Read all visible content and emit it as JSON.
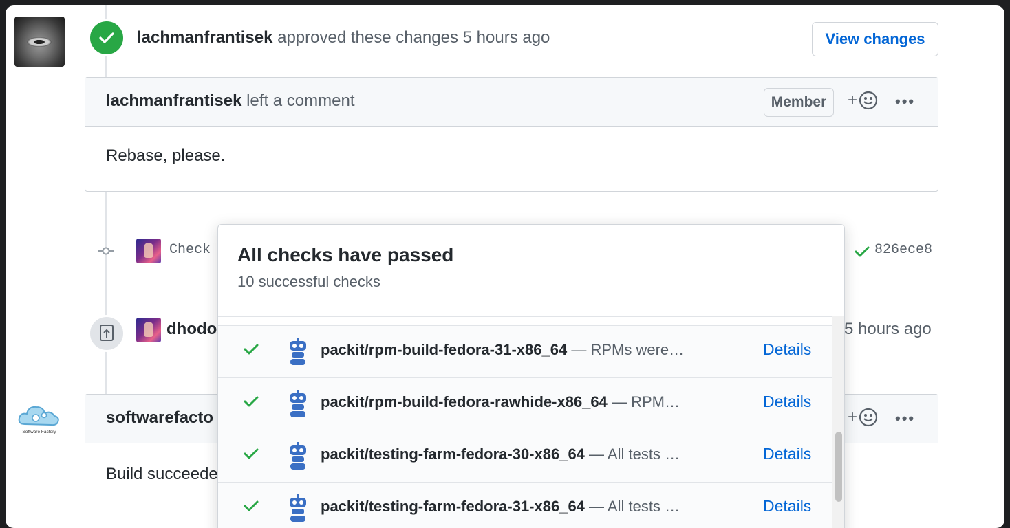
{
  "approval": {
    "author": "lachmanfrantisek",
    "action": "approved these changes",
    "time": "5 hours ago",
    "view_changes_label": "View changes"
  },
  "comment1": {
    "author": "lachmanfrantisek",
    "action": "left a comment",
    "badge": "Member",
    "reaction_plus": "+",
    "more": "•••",
    "body": "Rebase, please."
  },
  "commit": {
    "text": "Check",
    "sha": "826ece8"
  },
  "event2": {
    "author": "dhodo",
    "time": "5 hours ago"
  },
  "comment2": {
    "author": "softwarefacto",
    "logo_text": "Software Factory",
    "reaction_plus": "+",
    "more": "•••",
    "body": "Build succeede"
  },
  "checks_popover": {
    "title": "All checks have passed",
    "subtitle": "10 successful checks",
    "items": [
      {
        "name": "packit/rpm-build-fedora-31-x86_64",
        "desc": " — RPMs were…",
        "details": "Details"
      },
      {
        "name": "packit/rpm-build-fedora-rawhide-x86_64",
        "desc": " — RPM…",
        "details": "Details"
      },
      {
        "name": "packit/testing-farm-fedora-30-x86_64",
        "desc": " — All tests …",
        "details": "Details"
      },
      {
        "name": "packit/testing-farm-fedora-31-x86_64",
        "desc": " — All tests …",
        "details": "Details"
      }
    ]
  },
  "colors": {
    "success": "#28a745",
    "link": "#0366d6",
    "bot": "#3a6fc4"
  }
}
